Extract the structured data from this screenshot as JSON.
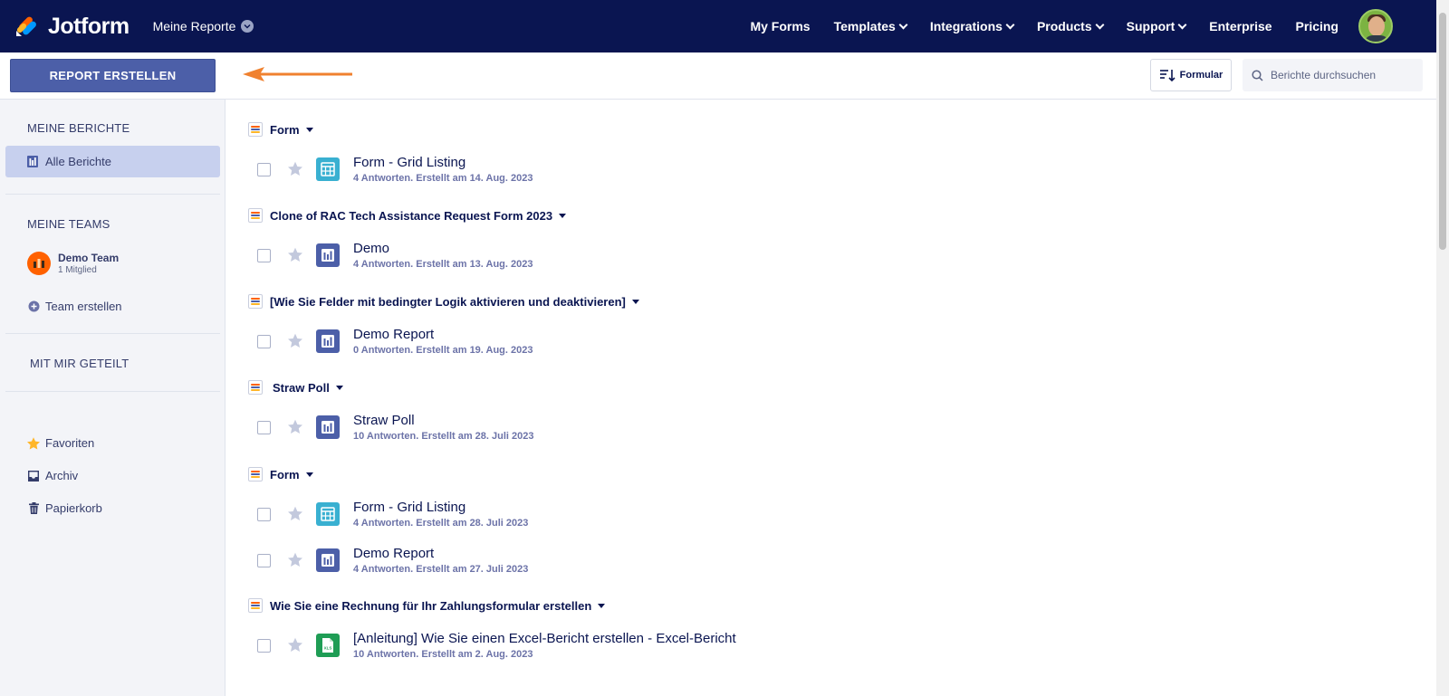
{
  "header": {
    "logo_text": "Jotform",
    "workspace_label": "Meine Reporte",
    "nav": [
      {
        "label": "My Forms",
        "dropdown": false
      },
      {
        "label": "Templates",
        "dropdown": true
      },
      {
        "label": "Integrations",
        "dropdown": true
      },
      {
        "label": "Products",
        "dropdown": true
      },
      {
        "label": "Support",
        "dropdown": true
      },
      {
        "label": "Enterprise",
        "dropdown": false
      },
      {
        "label": "Pricing",
        "dropdown": false
      }
    ]
  },
  "toolbar": {
    "create_label": "REPORT ERSTELLEN",
    "sort_label": "Formular",
    "search_placeholder": "Berichte durchsuchen"
  },
  "sidebar": {
    "my_reports_heading": "MEINE BERICHTE",
    "all_reports_label": "Alle Berichte",
    "my_teams_heading": "MEINE TEAMS",
    "team": {
      "name": "Demo Team",
      "members": "1 Mitglied"
    },
    "create_team_label": "Team erstellen",
    "shared_heading": "MIT MIR GETEILT",
    "favorites_label": "Favoriten",
    "archive_label": "Archiv",
    "trash_label": "Papierkorb"
  },
  "groups": [
    {
      "name": "Form",
      "reports": [
        {
          "title": "Form - Grid Listing",
          "meta": "4 Antworten. Erstellt am 14. Aug. 2023",
          "icon": "grid-report-icon"
        }
      ]
    },
    {
      "name": "Clone of RAC Tech Assistance Request Form 2023",
      "reports": [
        {
          "title": "Demo",
          "meta": "4 Antworten. Erstellt am 13. Aug. 2023",
          "icon": "chart-report-icon"
        }
      ]
    },
    {
      "name": "[Wie Sie Felder mit bedingter Logik aktivieren und deaktivieren]",
      "reports": [
        {
          "title": "Demo Report",
          "meta": "0 Antworten. Erstellt am 19. Aug. 2023",
          "icon": "chart-report-icon"
        }
      ]
    },
    {
      "name": "Straw Poll",
      "reports": [
        {
          "title": "Straw Poll",
          "meta": "10 Antworten. Erstellt am 28. Juli 2023",
          "icon": "chart-report-icon"
        }
      ]
    },
    {
      "name": "Form",
      "reports": [
        {
          "title": "Form - Grid Listing",
          "meta": "4 Antworten. Erstellt am 28. Juli 2023",
          "icon": "grid-report-icon"
        },
        {
          "title": "Demo Report",
          "meta": "4 Antworten. Erstellt am 27. Juli 2023",
          "icon": "chart-report-icon"
        }
      ]
    },
    {
      "name": "Wie Sie eine Rechnung für Ihr Zahlungsformular erstellen",
      "reports": [
        {
          "title": "[Anleitung] Wie Sie einen Excel-Bericht erstellen - Excel-Bericht",
          "meta": "10 Antworten. Erstellt am 2. Aug. 2023",
          "icon": "excel-report-icon"
        }
      ]
    }
  ],
  "colors": {
    "header_bg": "#0a1551",
    "primary_button": "#4c5fa8",
    "sidebar_active": "#c7d0ee",
    "grid_icon": "#39b0d1",
    "chart_icon": "#4c5fa8",
    "excel_icon": "#1f9d55",
    "arrow": "#f0812f"
  }
}
